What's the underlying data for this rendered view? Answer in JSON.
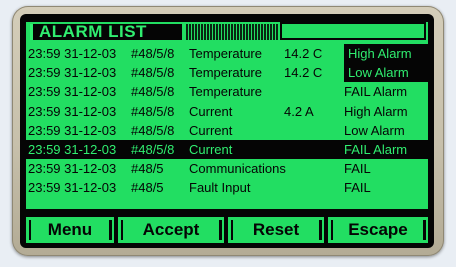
{
  "title": "ALARM LIST",
  "rows": [
    {
      "time": "23:59 31-12-03",
      "device": "#48/5/8",
      "param": "Temperature",
      "value": "14.2 C",
      "status": "High Alarm",
      "selected": false,
      "status_inverted": true
    },
    {
      "time": "23:59 31-12-03",
      "device": "#48/5/8",
      "param": "Temperature",
      "value": "14.2 C",
      "status": "Low Alarm",
      "selected": false,
      "status_inverted": true
    },
    {
      "time": "23:59 31-12-03",
      "device": "#48/5/8",
      "param": "Temperature",
      "value": "",
      "status": "FAIL Alarm",
      "selected": false,
      "status_inverted": false
    },
    {
      "time": "23:59 31-12-03",
      "device": "#48/5/8",
      "param": "Current",
      "value": "4.2 A",
      "status": "High Alarm",
      "selected": false,
      "status_inverted": false
    },
    {
      "time": "23:59 31-12-03",
      "device": "#48/5/8",
      "param": "Current",
      "value": "",
      "status": "Low Alarm",
      "selected": false,
      "status_inverted": false
    },
    {
      "time": "23:59 31-12-03",
      "device": "#48/5/8",
      "param": "Current",
      "value": "",
      "status": "FAIL Alarm",
      "selected": true,
      "status_inverted": false
    },
    {
      "time": "23:59 31-12-03",
      "device": "#48/5",
      "param": "Communications",
      "value": "",
      "status": "FAIL",
      "selected": false,
      "status_inverted": false
    },
    {
      "time": "23:59 31-12-03",
      "device": "#48/5",
      "param": "Fault Input",
      "value": "",
      "status": "FAIL",
      "selected": false,
      "status_inverted": false
    }
  ],
  "softkeys": {
    "menu": "Menu",
    "accept": "Accept",
    "reset": "Reset",
    "escape": "Escape"
  },
  "colors": {
    "lcd_green": "#22de62",
    "lcd_black": "#050505",
    "bezel": "#c7c0ab"
  }
}
